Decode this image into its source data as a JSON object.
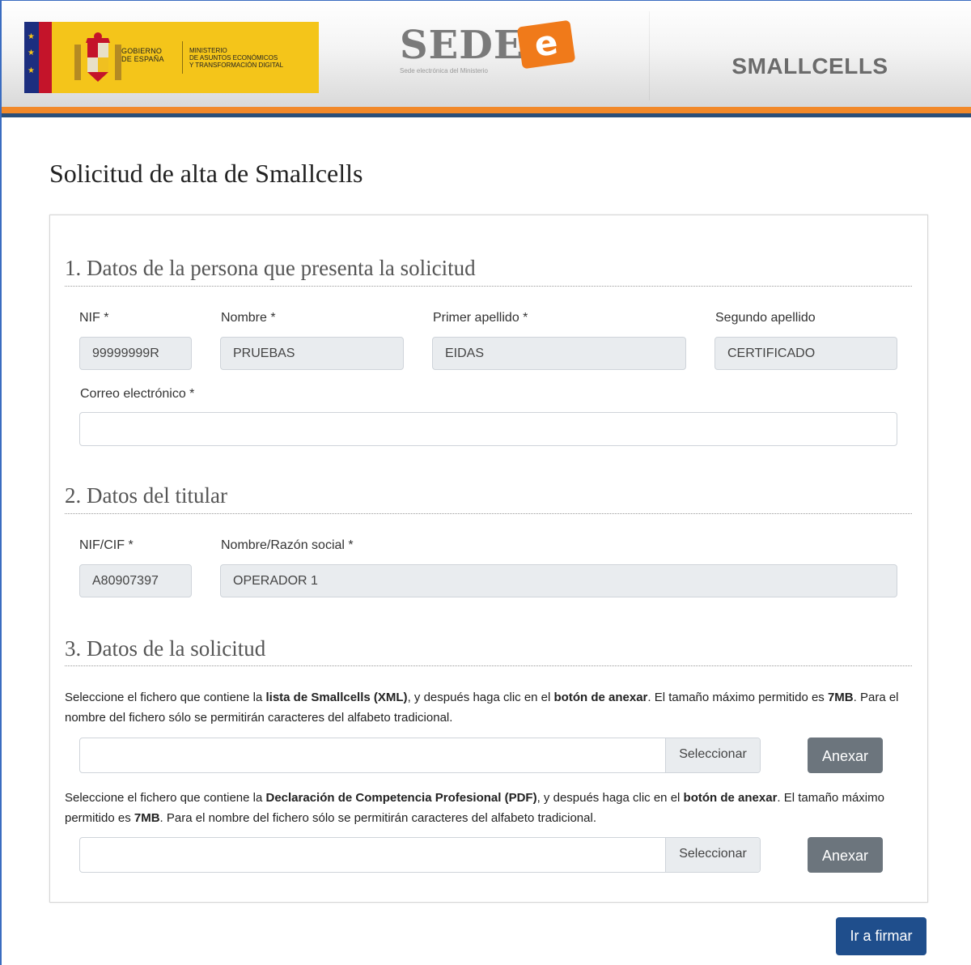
{
  "header": {
    "gobierno": [
      "GOBIERNO",
      "DE ESPAÑA"
    ],
    "ministerio": [
      "MINISTERIO",
      "DE ASUNTOS ECONÓMICOS",
      "Y TRANSFORMACIÓN DIGITAL"
    ],
    "sede_word": "SEDE-",
    "sede_e": "e",
    "sede_subtitle": "Sede electrónica del Ministerio",
    "app_name": "SMALLCELLS"
  },
  "page": {
    "title": "Solicitud de alta de Smallcells"
  },
  "section1": {
    "title": "1. Datos de la persona que presenta la solicitud",
    "nif_label": "NIF *",
    "nif_value": "99999999R",
    "nombre_label": "Nombre *",
    "nombre_value": "PRUEBAS",
    "apellido1_label": "Primer apellido *",
    "apellido1_value": "EIDAS",
    "apellido2_label": "Segundo apellido",
    "apellido2_value": "CERTIFICADO",
    "email_label": "Correo electrónico *",
    "email_value": ""
  },
  "section2": {
    "title": "2. Datos del titular",
    "nifcif_label": "NIF/CIF *",
    "nifcif_value": "A80907397",
    "razon_label": "Nombre/Razón social *",
    "razon_value": "OPERADOR 1"
  },
  "section3": {
    "title": "3. Datos de la solicitud",
    "xml_help": {
      "p1": "Seleccione el fichero que contiene la ",
      "b1": "lista de Smallcells (XML)",
      "p2": ", y después haga clic en el ",
      "b2": "botón de anexar",
      "p3": ". El tamaño máximo permitido es ",
      "b3": "7MB",
      "p4": ". Para el nombre del fichero sólo se permitirán caracteres del alfabeto tradicional."
    },
    "pdf_help": {
      "p1": "Seleccione el fichero que contiene la ",
      "b1": "Declaración de Competencia Profesional (PDF)",
      "p2": ", y después haga clic en el ",
      "b2": "botón de anexar",
      "p3": ". El tamaño máximo permitido es ",
      "b3": "7MB",
      "p4": ". Para el nombre del fichero sólo se permitirán caracteres del alfabeto tradicional."
    },
    "select_label": "Seleccionar",
    "anexar_label": "Anexar"
  },
  "actions": {
    "submit_label": "Ir a firmar"
  },
  "colors": {
    "accent_orange": "#f2892a",
    "accent_blue": "#2a4f7a",
    "primary_button": "#1f4e8c",
    "secondary_button": "#6c757d",
    "readonly_input": "#e9ecef"
  }
}
